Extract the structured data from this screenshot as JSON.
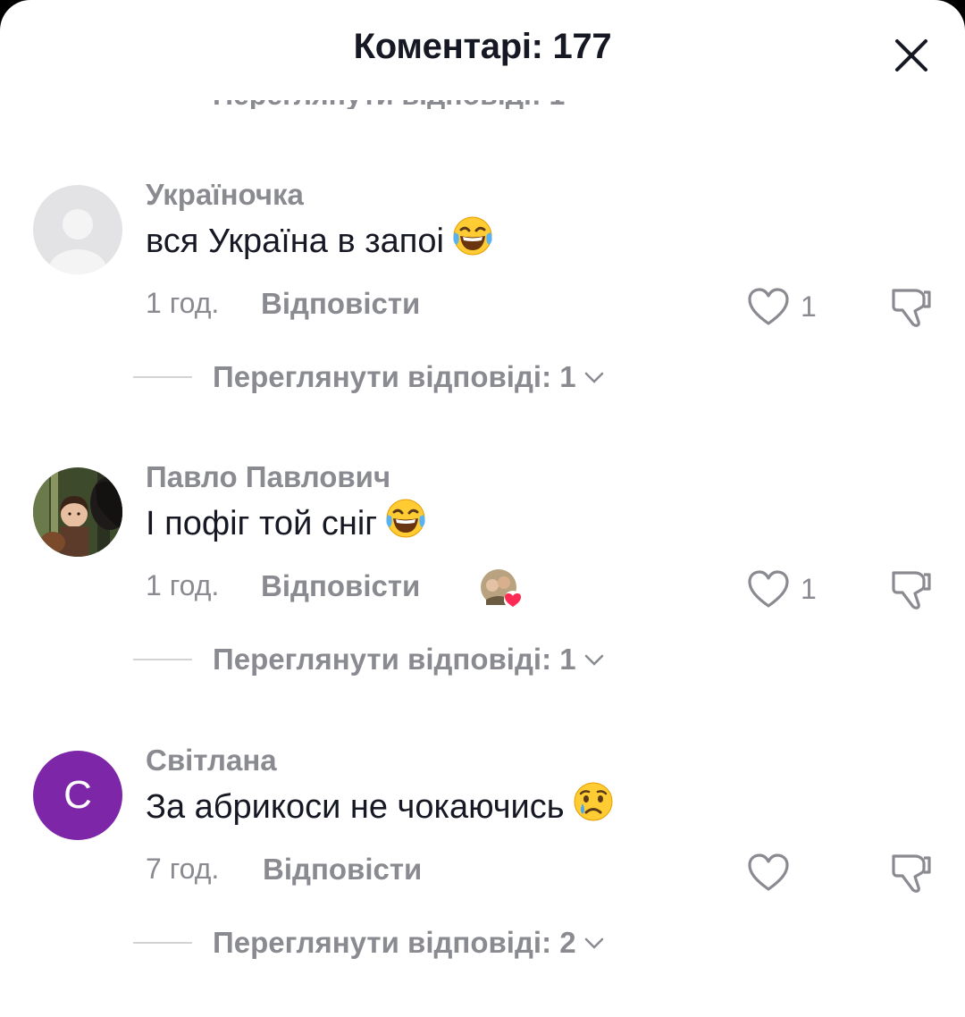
{
  "header": {
    "title": "Коментарі: 177"
  },
  "cut_off_text": "Переглянути відповіді: 1",
  "comments": [
    {
      "username": "Україночка",
      "text": "вся Україна в запоі",
      "emoji": "laughing-tears-emoji",
      "time": "1 год.",
      "reply_label": "Відповісти",
      "likes": "1",
      "view_replies": "Переглянути відповіді: 1",
      "avatar": "default-avatar"
    },
    {
      "username": "Павло Павлович",
      "text": "І пофіг той сніг",
      "emoji": "laughing-tears-emoji",
      "time": "1 год.",
      "reply_label": "Відповісти",
      "likes": "1",
      "view_replies": "Переглянути відповіді: 1",
      "avatar": "photo-avatar",
      "creator_liked": true
    },
    {
      "username": "Світлана",
      "text": "За абрикоси не чокаючись",
      "emoji": "crying-emoji",
      "time": "7 год.",
      "reply_label": "Відповісти",
      "likes": "",
      "view_replies": "Переглянути відповіді: 2",
      "avatar": "letter-avatar",
      "avatar_letter": "С",
      "avatar_color": "#7d27a8"
    }
  ],
  "colors": {
    "text": "#161823",
    "muted": "#8a8b91",
    "heart": "#fe2c55"
  }
}
